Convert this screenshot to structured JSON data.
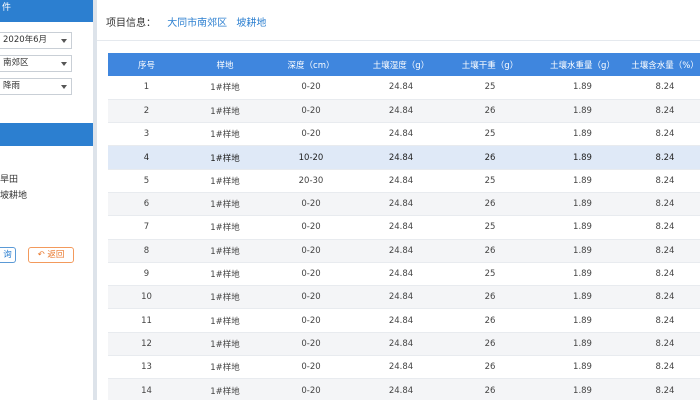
{
  "sidebar": {
    "title": "件",
    "filters": [
      {
        "value": "2020年6月"
      },
      {
        "value": "南郊区"
      },
      {
        "value": "降雨"
      }
    ],
    "section_title": "",
    "items": [
      "旱田",
      "坡耕地"
    ],
    "btn_left_label": "询",
    "btn_back_label": "返回",
    "back_icon": "undo-icon"
  },
  "main": {
    "info_label": "项目信息：",
    "info_region": "大同市南郊区",
    "info_land": "坡耕地"
  },
  "table": {
    "headers": [
      "序号",
      "样地",
      "深度（cm）",
      "土壤湿度（g）",
      "土壤干重（g）",
      "土壤水重量（g）",
      "土壤含水量（%）"
    ],
    "rows": [
      [
        "1",
        "1#样地",
        "0-20",
        "24.84",
        "25",
        "1.89",
        "8.24"
      ],
      [
        "2",
        "1#样地",
        "0-20",
        "24.84",
        "26",
        "1.89",
        "8.24"
      ],
      [
        "3",
        "1#样地",
        "0-20",
        "24.84",
        "25",
        "1.89",
        "8.24"
      ],
      [
        "4",
        "1#样地",
        "10-20",
        "24.84",
        "26",
        "1.89",
        "8.24"
      ],
      [
        "5",
        "1#样地",
        "20-30",
        "24.84",
        "25",
        "1.89",
        "8.24"
      ],
      [
        "6",
        "1#样地",
        "0-20",
        "24.84",
        "26",
        "1.89",
        "8.24"
      ],
      [
        "7",
        "1#样地",
        "0-20",
        "24.84",
        "25",
        "1.89",
        "8.24"
      ],
      [
        "8",
        "1#样地",
        "0-20",
        "24.84",
        "26",
        "1.89",
        "8.24"
      ],
      [
        "9",
        "1#样地",
        "0-20",
        "24.84",
        "25",
        "1.89",
        "8.24"
      ],
      [
        "10",
        "1#样地",
        "0-20",
        "24.84",
        "26",
        "1.89",
        "8.24"
      ],
      [
        "11",
        "1#样地",
        "0-20",
        "24.84",
        "26",
        "1.89",
        "8.24"
      ],
      [
        "12",
        "1#样地",
        "0-20",
        "24.84",
        "26",
        "1.89",
        "8.24"
      ],
      [
        "13",
        "1#样地",
        "0-20",
        "24.84",
        "26",
        "1.89",
        "8.24"
      ],
      [
        "14",
        "1#样地",
        "0-20",
        "24.84",
        "26",
        "1.89",
        "8.24"
      ]
    ],
    "highlighted_row": 4
  },
  "colors": {
    "accent": "#2c7fd0",
    "header_bg": "#3f86de",
    "highlight_row": "#dfe9f7",
    "back_button": "#e9772b"
  }
}
